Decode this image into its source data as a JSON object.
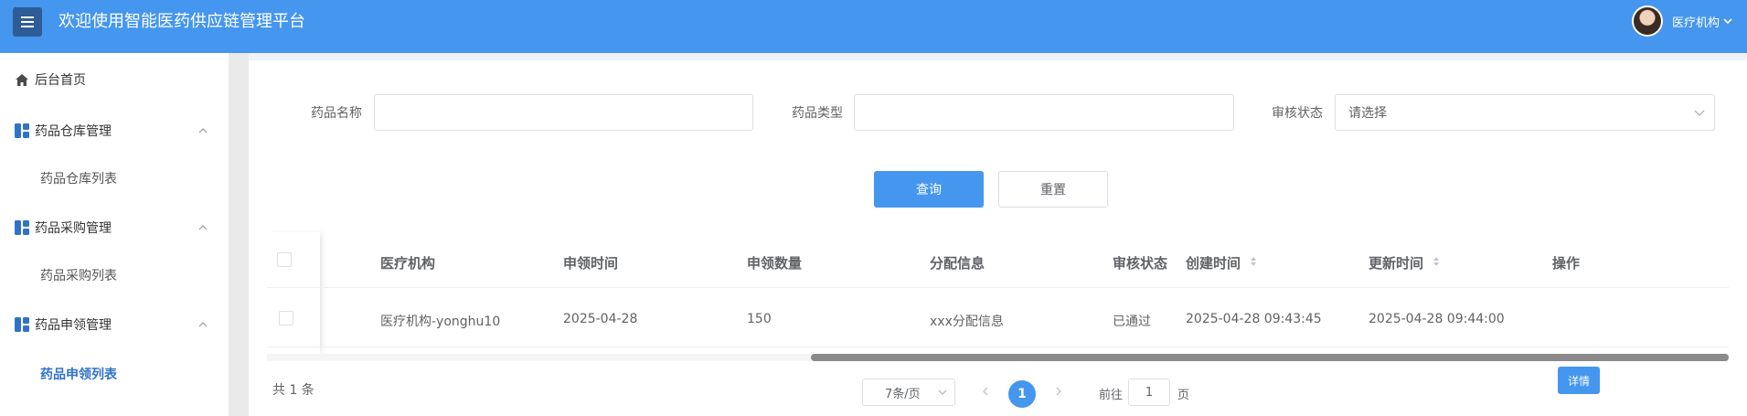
{
  "header": {
    "title": "欢迎使用智能医药供应链管理平台",
    "user_name": "医疗机构",
    "colors": {
      "header_bg": "#4596ee",
      "menu_btn_bg": "#2d5c97"
    }
  },
  "sidebar": {
    "home_label": "后台首页",
    "groups": [
      {
        "label": "药品仓库管理",
        "items": [
          {
            "label": "药品仓库列表",
            "active": false
          }
        ]
      },
      {
        "label": "药品采购管理",
        "items": [
          {
            "label": "药品采购列表",
            "active": false
          }
        ]
      },
      {
        "label": "药品申领管理",
        "items": [
          {
            "label": "药品申领列表",
            "active": true
          }
        ]
      }
    ],
    "icons": {
      "home": "home-icon",
      "group": "grid-icon",
      "collapse": "chevron-up-icon"
    }
  },
  "filters": {
    "drug_name": {
      "label": "药品名称",
      "value": "",
      "placeholder": ""
    },
    "drug_type": {
      "label": "药品类型",
      "value": "",
      "placeholder": ""
    },
    "audit_status": {
      "label": "审核状态",
      "value": "请选择"
    },
    "search_label": "查询",
    "reset_label": "重置"
  },
  "table": {
    "headers": [
      "医疗机构",
      "申领时间",
      "申领数量",
      "分配信息",
      "审核状态",
      "创建时间",
      "更新时间",
      "操作"
    ],
    "rows": [
      {
        "institution": "医疗机构-yonghu10",
        "apply_date": "2025-04-28",
        "quantity": "150",
        "allocation": "xxx分配信息",
        "status": "已通过",
        "created": "2025-04-28 09:43:45",
        "updated": "2025-04-28 09:44:00",
        "action": "详情"
      }
    ]
  },
  "pagination": {
    "total_text": "共 1 条",
    "page_size": "7条/页",
    "current_page": "1",
    "goto_prefix": "前往",
    "goto_value": "1",
    "goto_suffix": "页"
  }
}
